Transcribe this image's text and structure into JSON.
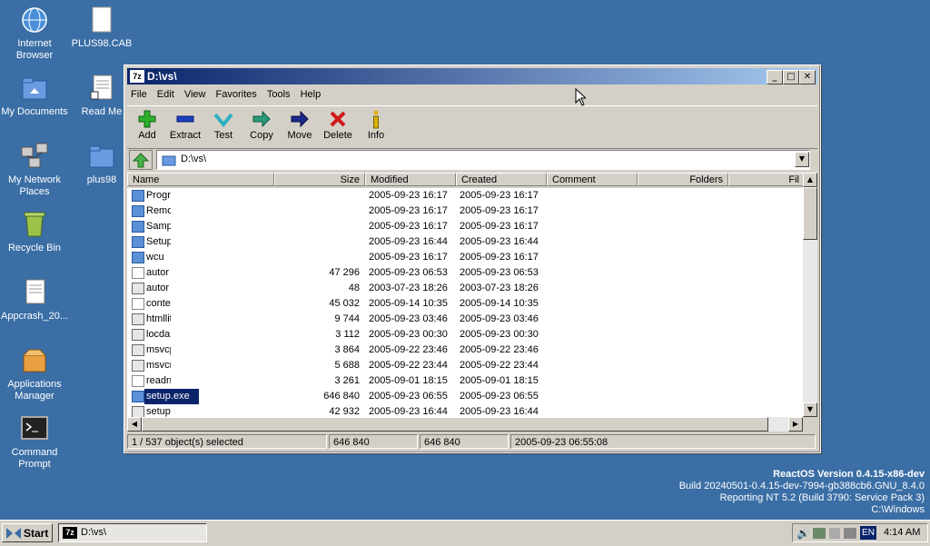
{
  "desktop": {
    "icons": [
      {
        "label": "Internet Browser"
      },
      {
        "label": "PLUS98.CAB"
      },
      {
        "label": "My Documents"
      },
      {
        "label": "Read Me"
      },
      {
        "label": "My Network Places"
      },
      {
        "label": "plus98"
      },
      {
        "label": "Recycle Bin"
      },
      {
        "label": "Appcrash_20..."
      },
      {
        "label": "Applications Manager"
      },
      {
        "label": "Command Prompt"
      }
    ],
    "version": {
      "line1": "ReactOS Version 0.4.15-x86-dev",
      "line2": "Build 20240501-0.4.15-dev-7994-gb388cb6.GNU_8.4.0",
      "line3": "Reporting NT 5.2 (Build 3790: Service Pack 3)",
      "line4": "C:\\Windows"
    }
  },
  "window": {
    "title": "D:\\vs\\",
    "title_icon": "7z",
    "menu": [
      "File",
      "Edit",
      "View",
      "Favorites",
      "Tools",
      "Help"
    ],
    "toolbar": [
      {
        "label": "Add",
        "icon": "add-icon"
      },
      {
        "label": "Extract",
        "icon": "extract-icon"
      },
      {
        "label": "Test",
        "icon": "test-icon"
      },
      {
        "label": "Copy",
        "icon": "copy-icon"
      },
      {
        "label": "Move",
        "icon": "move-icon"
      },
      {
        "label": "Delete",
        "icon": "delete-icon"
      },
      {
        "label": "Info",
        "icon": "info-icon"
      }
    ],
    "address": "D:\\vs\\",
    "columns": [
      "Name",
      "Size",
      "Modified",
      "Created",
      "Comment",
      "Folders",
      "Fil"
    ],
    "files": [
      {
        "name": "Progr",
        "size": "",
        "modified": "2005-09-23 16:17",
        "created": "2005-09-23 16:17",
        "type": "folder"
      },
      {
        "name": "Remo",
        "size": "",
        "modified": "2005-09-23 16:17",
        "created": "2005-09-23 16:17",
        "type": "folder"
      },
      {
        "name": "Samp",
        "size": "",
        "modified": "2005-09-23 16:17",
        "created": "2005-09-23 16:17",
        "type": "folder"
      },
      {
        "name": "Setup",
        "size": "",
        "modified": "2005-09-23 16:44",
        "created": "2005-09-23 16:44",
        "type": "folder"
      },
      {
        "name": "wcu",
        "size": "",
        "modified": "2005-09-23 16:17",
        "created": "2005-09-23 16:17",
        "type": "folder"
      },
      {
        "name": "autor",
        "size": "47 296",
        "modified": "2005-09-23 06:53",
        "created": "2005-09-23 06:53",
        "type": "doc"
      },
      {
        "name": "autor",
        "size": "48",
        "modified": "2003-07-23 18:26",
        "created": "2003-07-23 18:26",
        "type": "gear"
      },
      {
        "name": "conte",
        "size": "45 032",
        "modified": "2005-09-14 10:35",
        "created": "2005-09-14 10:35",
        "type": "doc"
      },
      {
        "name": "htmllit",
        "size": "9 744",
        "modified": "2005-09-23 03:46",
        "created": "2005-09-23 03:46",
        "type": "gear"
      },
      {
        "name": "locdal",
        "size": "3 112",
        "modified": "2005-09-23 00:30",
        "created": "2005-09-23 00:30",
        "type": "gear"
      },
      {
        "name": "msvcp",
        "size": "3 864",
        "modified": "2005-09-22 23:46",
        "created": "2005-09-22 23:46",
        "type": "gear"
      },
      {
        "name": "msvcr",
        "size": "5 688",
        "modified": "2005-09-22 23:44",
        "created": "2005-09-22 23:44",
        "type": "gear"
      },
      {
        "name": "readn",
        "size": "3 261",
        "modified": "2005-09-01 18:15",
        "created": "2005-09-01 18:15",
        "type": "doc"
      },
      {
        "name": "setup.exe",
        "size": "646 840",
        "modified": "2005-09-23 06:55",
        "created": "2005-09-23 06:55",
        "type": "exe",
        "selected": true
      },
      {
        "name": "setup.ini",
        "size": "42 932",
        "modified": "2005-09-23 16:44",
        "created": "2005-09-23 16:44",
        "type": "gear"
      }
    ],
    "status": {
      "selection": "1 / 537 object(s) selected",
      "size1": "646 840",
      "size2": "646 840",
      "date": "2005-09-23 06:55:08"
    }
  },
  "taskbar": {
    "start": "Start",
    "task": "D:\\vs\\",
    "task_icon": "7z",
    "lang": "EN",
    "time": "4:14 AM"
  },
  "colors": {
    "desktop": "#3a6ea5",
    "title_start": "#0a246a",
    "title_end": "#a6caf0",
    "selection": "#0a246a"
  }
}
